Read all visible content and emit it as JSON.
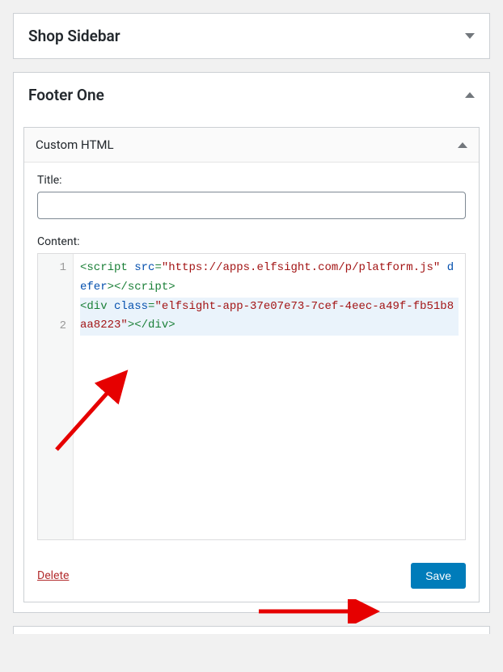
{
  "sidebars": {
    "shop_sidebar": {
      "title": "Shop Sidebar"
    },
    "footer_one": {
      "title": "Footer One"
    }
  },
  "widget": {
    "heading": "Custom HTML",
    "title_label": "Title:",
    "title_value": "",
    "content_label": "Content:",
    "code": {
      "line1": {
        "tag_open": "<script",
        "attr_name": "src",
        "attr_value": "\"https://apps.elfsight.com/p/platform.js\"",
        "defer": "defer",
        "tag_close": "></script>"
      },
      "line2": {
        "tag_open": "<div",
        "attr_name": "class",
        "attr_value": "\"elfsight-app-37e07e73-7cef-4eec-a49f-fb51b8aa8223\"",
        "tag_close": "></div>"
      },
      "gutter": [
        "1",
        "2"
      ]
    },
    "actions": {
      "delete": "Delete",
      "save": "Save"
    }
  }
}
